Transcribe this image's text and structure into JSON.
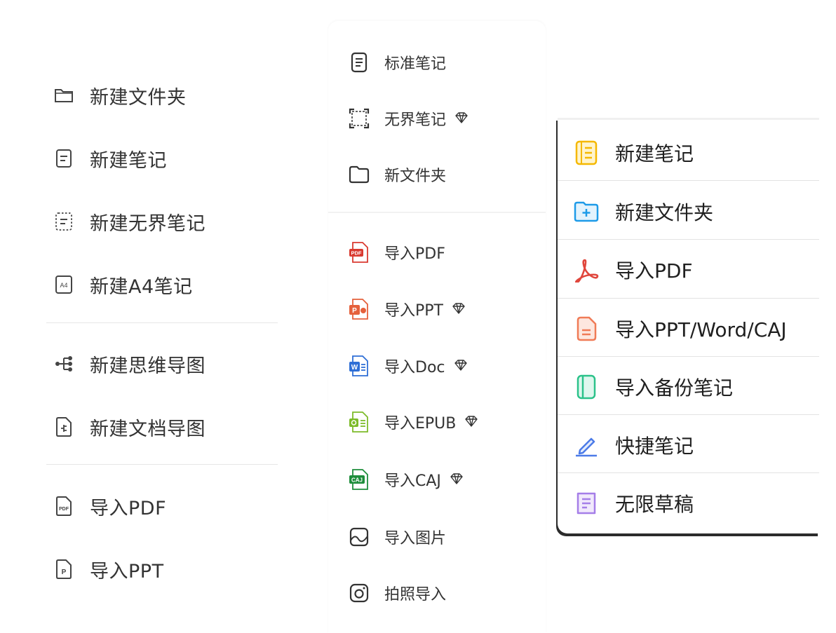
{
  "panel1": {
    "items": [
      {
        "label": "新建文件夹",
        "icon": "folder-icon"
      },
      {
        "label": "新建笔记",
        "icon": "note-icon"
      },
      {
        "label": "新建无界笔记",
        "icon": "dashed-note-icon"
      },
      {
        "label": "新建A4笔记",
        "icon": "a4-icon"
      },
      {
        "label": "新建思维导图",
        "icon": "mindmap-icon"
      },
      {
        "label": "新建文档导图",
        "icon": "doc-map-icon"
      },
      {
        "label": "导入PDF",
        "icon": "pdf-file-icon"
      },
      {
        "label": "导入PPT",
        "icon": "ppt-file-icon"
      }
    ],
    "pdf_badge": "PDF",
    "a4_badge": "A4",
    "ppt_badge": "P"
  },
  "panel2": {
    "items": [
      {
        "label": "标准笔记",
        "icon": "standard-note-icon"
      },
      {
        "label": "无界笔记",
        "icon": "infinite-canvas-icon",
        "premium": true
      },
      {
        "label": "新文件夹",
        "icon": "folder-icon"
      },
      {
        "label": "导入PDF",
        "icon": "pdf-icon"
      },
      {
        "label": "导入PPT",
        "icon": "ppt-icon",
        "premium": true
      },
      {
        "label": "导入Doc",
        "icon": "word-icon",
        "premium": true
      },
      {
        "label": "导入EPUB",
        "icon": "epub-icon",
        "premium": true
      },
      {
        "label": "导入CAJ",
        "icon": "caj-icon",
        "premium": true
      },
      {
        "label": "导入图片",
        "icon": "image-icon"
      },
      {
        "label": "拍照导入",
        "icon": "camera-icon"
      }
    ],
    "badges": {
      "pdf": "PDF",
      "ppt": "P",
      "word": "W",
      "caj": "CAJ"
    }
  },
  "panel3": {
    "items": [
      {
        "label": "新建笔记",
        "icon": "notebook-icon",
        "color": "#F5B800"
      },
      {
        "label": "新建文件夹",
        "icon": "folder-add-icon",
        "color": "#1E9BE8"
      },
      {
        "label": "导入PDF",
        "icon": "acrobat-icon",
        "color": "#E0463C"
      },
      {
        "label": "导入PPT/Word/CAJ",
        "icon": "document-icon",
        "color": "#F07B57"
      },
      {
        "label": "导入备份笔记",
        "icon": "backup-note-icon",
        "color": "#2BC28A"
      },
      {
        "label": "快捷笔记",
        "icon": "pen-icon",
        "color": "#4C7BE8"
      },
      {
        "label": "无限草稿",
        "icon": "draft-icon",
        "color": "#A57EE8"
      }
    ]
  },
  "colors": {
    "pdf_red": "#D93A30",
    "ppt_orange": "#E5613C",
    "word_blue": "#2F6FD6",
    "epub_green": "#7DBB2A",
    "caj_green": "#1F8E3C"
  }
}
